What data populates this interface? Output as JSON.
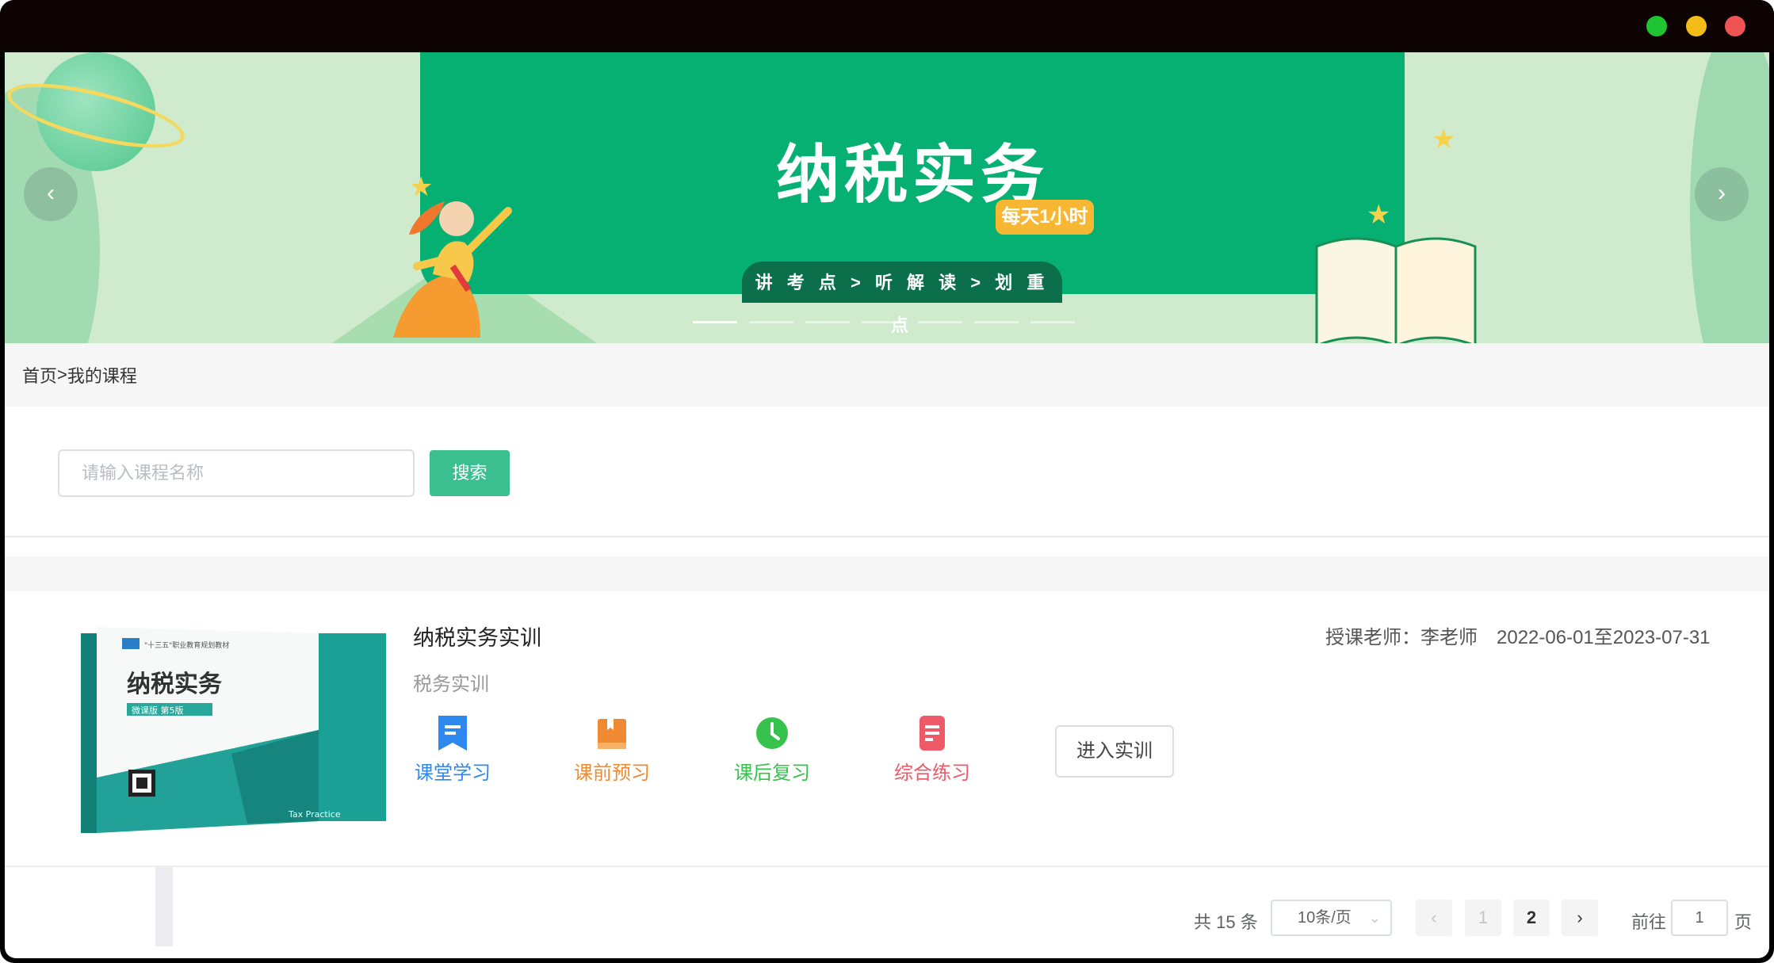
{
  "banner": {
    "title": "纳税实务",
    "badge": "每天1小时",
    "subtitle": "讲 考 点 > 听 解 读 > 划 重 点",
    "prev_icon": "chevron-left-icon",
    "next_icon": "chevron-right-icon",
    "prev_glyph": "‹",
    "next_glyph": "›",
    "indicator_count": 7,
    "active_index": 0
  },
  "breadcrumb": {
    "home": "首页",
    "separator": ">",
    "current": "我的课程"
  },
  "search": {
    "placeholder": "请输入课程名称",
    "value": "",
    "button_label": "搜索"
  },
  "course": {
    "cover": {
      "title": "纳税实务",
      "series": "\"十三五\"职业教育规划教材",
      "edition": "微课版 第5版",
      "english": "Tax Practice"
    },
    "title": "纳税实务实训",
    "type": "税务实训",
    "teacher": "授课老师：李老师",
    "dates": "2022-06-01至2023-07-31",
    "actions": [
      {
        "label": "课堂学习",
        "icon": "bookmark-icon",
        "color": "#2d88f0"
      },
      {
        "label": "课前预习",
        "icon": "book-icon",
        "color": "#ef8a32"
      },
      {
        "label": "课后复习",
        "icon": "clock-icon",
        "color": "#36c24c"
      },
      {
        "label": "综合练习",
        "icon": "document-icon",
        "color": "#ee5a68"
      }
    ],
    "enter_label": "进入实训"
  },
  "pagination": {
    "total": "共 15 条",
    "page_size": "10条/页",
    "pages": [
      "1",
      "2"
    ],
    "current_page": "2",
    "goto_label": "前往",
    "goto_value": "1",
    "page_suffix": "页",
    "prev_glyph": "‹",
    "next_glyph": "›"
  },
  "colors": {
    "accent": "#3cbf8f",
    "banner_green": "#05b072",
    "banner_bg": "#cfeacd"
  }
}
